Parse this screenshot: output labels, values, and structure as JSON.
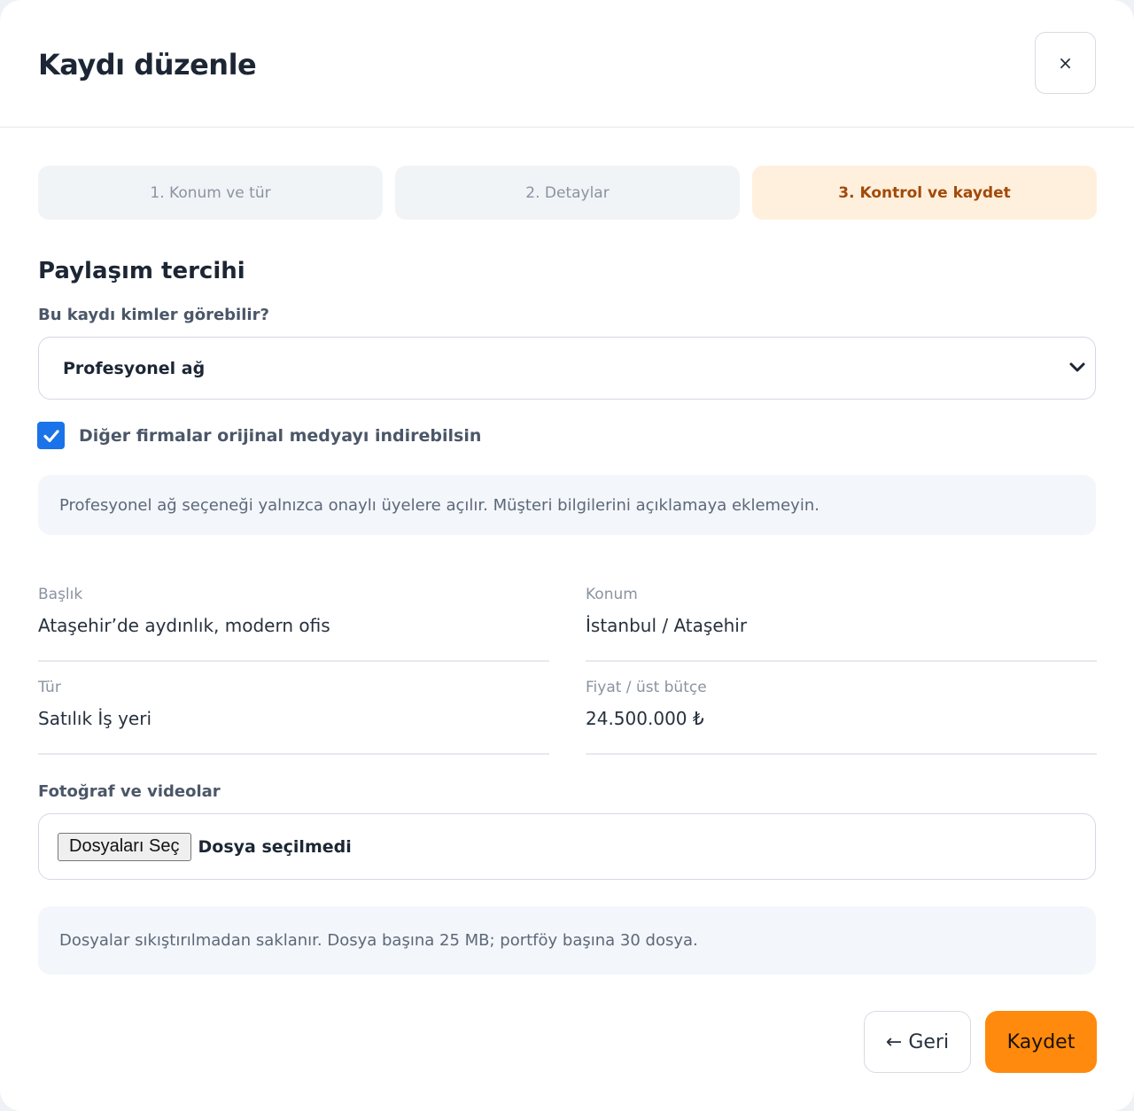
{
  "dialog": {
    "title": "Kaydı düzenle",
    "close_label": "×"
  },
  "steps": [
    {
      "label": "1. Konum ve tür",
      "active": false
    },
    {
      "label": "2. Detaylar",
      "active": false
    },
    {
      "label": "3. Kontrol ve kaydet",
      "active": true
    }
  ],
  "sharing": {
    "section_title": "Paylaşım tercihi",
    "visibility_label": "Bu kaydı kimler görebilir?",
    "visibility_value": "Profesyonel ağ",
    "download_checkbox_label": "Diğer firmalar orijinal medyayı indirebilsin",
    "download_checked": true,
    "note": "Profesyonel ağ seçeneği yalnızca onaylı üyelere açılır. Müşteri bilgilerini açıklamaya eklemeyin."
  },
  "summary": [
    {
      "key": "Başlık",
      "value": "Ataşehir’de aydınlık, modern ofis"
    },
    {
      "key": "Konum",
      "value": "İstanbul / Ataşehir"
    },
    {
      "key": "Tür",
      "value": "Satılık İş yeri"
    },
    {
      "key": "Fiyat / üst bütçe",
      "value": "24.500.000 ₺"
    }
  ],
  "media": {
    "label": "Fotoğraf ve videolar",
    "choose_button": "Dosyaları Seç",
    "status": "Dosya seçilmedi",
    "note": "Dosyalar sıkıştırılmadan saklanır. Dosya başına 25 MB; portföy başına 30 dosya."
  },
  "footer": {
    "back_label": "← Geri",
    "save_label": "Kaydet"
  },
  "colors": {
    "accent": "#ff8a0d",
    "active_step_bg": "#fff0de",
    "active_step_text": "#a24a08",
    "checkbox": "#1a73e8"
  }
}
